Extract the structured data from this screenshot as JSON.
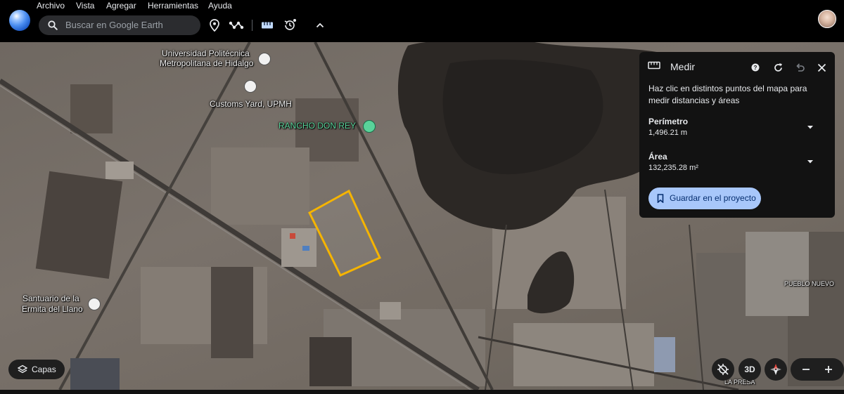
{
  "menu": {
    "items": [
      "Archivo",
      "Vista",
      "Agregar",
      "Herramientas",
      "Ayuda"
    ]
  },
  "toolbar": {
    "search_placeholder": "Buscar en Google Earth"
  },
  "map": {
    "labels": {
      "universidad": "Universidad Politécnica",
      "universidad_2": "Metropolitana de Hidalgo",
      "customs": "Customs Yard, UPMH",
      "rancho": "RANCHO DON REY",
      "santuario": "Santuario de la",
      "santuario_2": "Ermita del Llano",
      "pueblo_nuevo": "PUEBLO NUEVO",
      "la_presa": "LA PRESA"
    },
    "measured_polygon_color": "#f5b400"
  },
  "measure_panel": {
    "title": "Medir",
    "instruction": "Haz clic en distintos puntos del mapa para medir distancias y áreas",
    "perimeter_label": "Perímetro",
    "perimeter_value": "1,496.21 m",
    "area_label": "Área",
    "area_value": "132,235.28 m²",
    "save_label": "Guardar en el proyecto"
  },
  "controls": {
    "layers_label": "Capas",
    "threed_label": "3D"
  },
  "colors": {
    "accent": "#a8c7fa",
    "panel_bg": "#121212",
    "rancho_label": "#59d39a"
  }
}
